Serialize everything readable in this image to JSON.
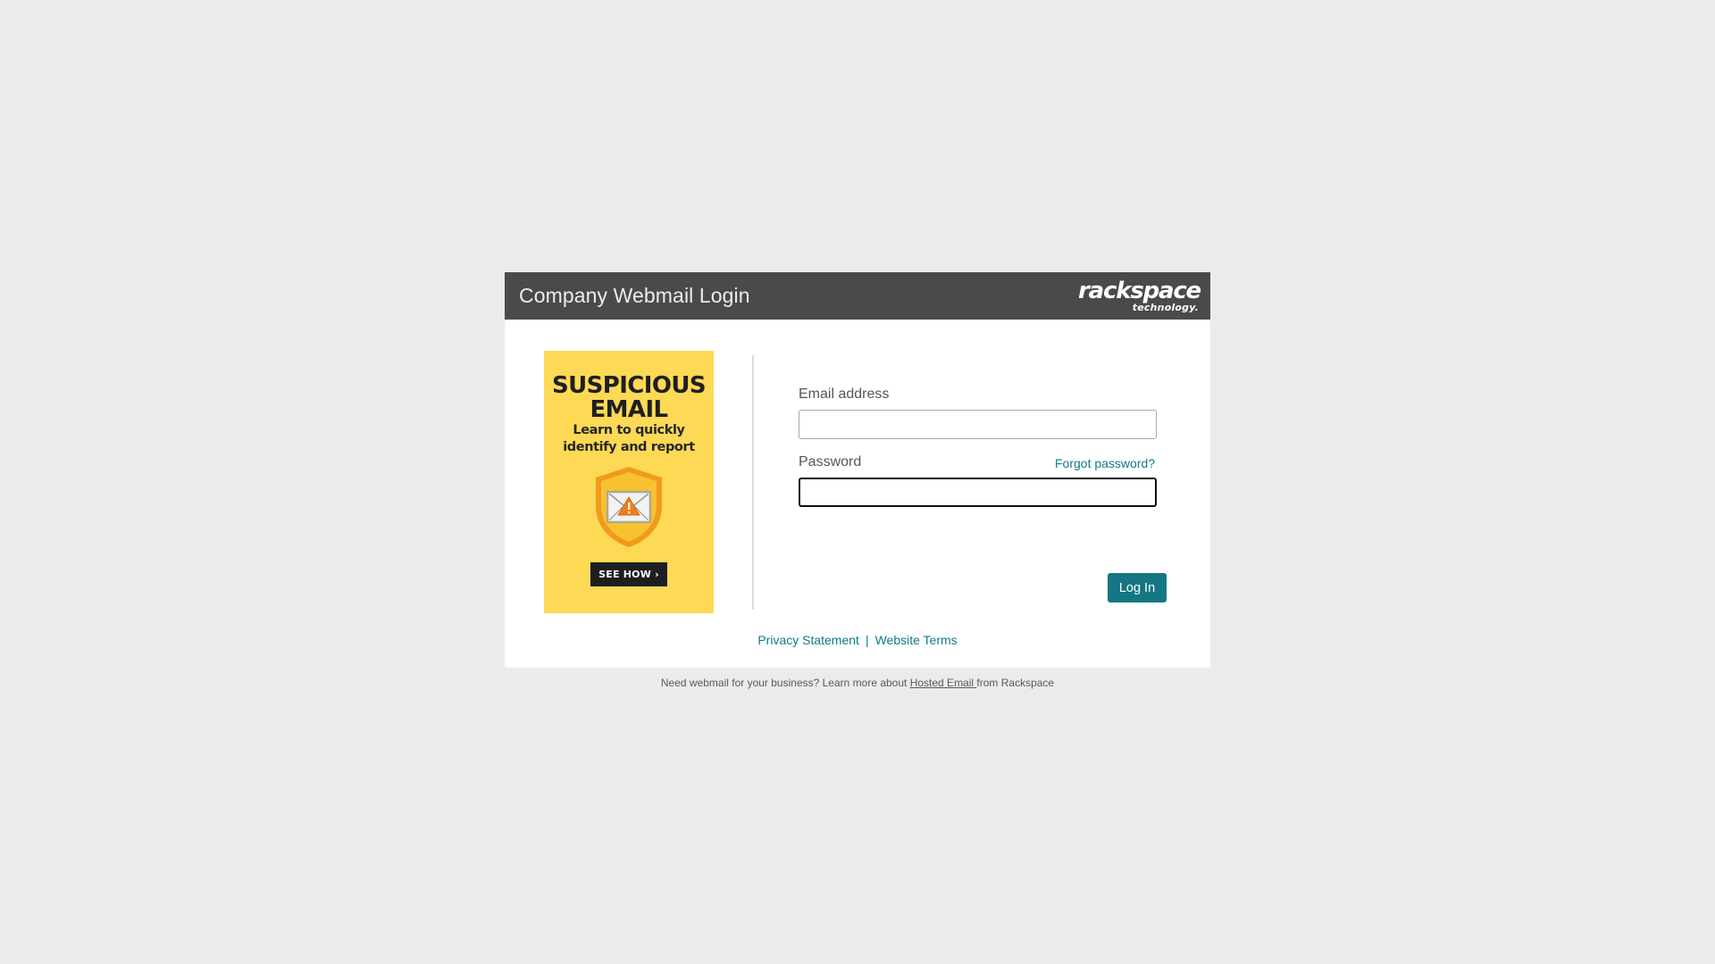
{
  "header": {
    "title": "Company Webmail Login",
    "brand_name": "rackspace",
    "brand_sub": "technology."
  },
  "promo": {
    "headline_line1": "SUSPICIOUS",
    "headline_line2": "EMAIL",
    "sub_line1": "Learn to quickly",
    "sub_line2": "identify and report",
    "cta_label": "SEE HOW ›",
    "icon": "shield-envelope-warning-icon",
    "background_color": "#fdd955"
  },
  "form": {
    "email_label": "Email address",
    "email_value": "",
    "password_label": "Password",
    "password_value": "",
    "forgot_label": "Forgot password?",
    "login_label": "Log In"
  },
  "links": {
    "privacy": "Privacy Statement",
    "separator": "|",
    "terms": "Website Terms"
  },
  "footer": {
    "text_before": "Need webmail for your business? Learn more about ",
    "link_label": "Hosted Email ",
    "text_after": "from Rackspace"
  },
  "colors": {
    "accent": "#147683",
    "link": "#0f7a86",
    "header_bg": "#4a4a4a",
    "page_bg": "#ebebeb"
  }
}
